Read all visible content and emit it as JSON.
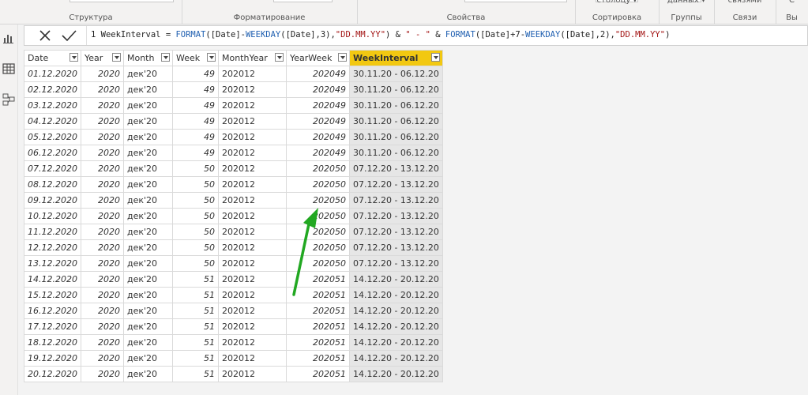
{
  "ribbon": {
    "groups": [
      {
        "label": "Структура",
        "top": ""
      },
      {
        "label": "Форматирование",
        "top": ""
      },
      {
        "label": "Свойства",
        "top": ""
      },
      {
        "label": "Сортировка",
        "top": "столбцу ▾"
      },
      {
        "label": "Группы",
        "top": "данных ▾"
      },
      {
        "label": "Связи",
        "top": "связями"
      },
      {
        "label": "Вы",
        "top": "С"
      }
    ]
  },
  "rail": {
    "icons": [
      "report-view-icon",
      "data-view-icon",
      "model-view-icon"
    ]
  },
  "formula": {
    "line_number": "1",
    "measure_name": "WeekInterval",
    "segments": [
      {
        "t": "1  WeekInterval = ",
        "c": ""
      },
      {
        "t": "FORMAT",
        "c": "kw"
      },
      {
        "t": "([Date]-",
        "c": ""
      },
      {
        "t": "WEEKDAY",
        "c": "kw"
      },
      {
        "t": "([Date],3),",
        "c": ""
      },
      {
        "t": "\"DD.MM.YY\"",
        "c": "st"
      },
      {
        "t": ") & ",
        "c": ""
      },
      {
        "t": "\" - \"",
        "c": "st"
      },
      {
        "t": " & ",
        "c": ""
      },
      {
        "t": "FORMAT",
        "c": "kw"
      },
      {
        "t": "([Date]+7-",
        "c": ""
      },
      {
        "t": "WEEKDAY",
        "c": "kw"
      },
      {
        "t": "([Date],2),",
        "c": ""
      },
      {
        "t": "\"DD.MM.YY\"",
        "c": "st"
      },
      {
        "t": ")",
        "c": ""
      }
    ]
  },
  "table": {
    "columns": [
      "Date",
      "Year",
      "Month",
      "Week",
      "MonthYear",
      "YearWeek",
      "WeekInterval"
    ],
    "selected_column": "WeekInterval",
    "rows": [
      [
        "01.12.2020",
        "2020",
        "дек'20",
        "49",
        "202012",
        "202049",
        "30.11.20 - 06.12.20"
      ],
      [
        "02.12.2020",
        "2020",
        "дек'20",
        "49",
        "202012",
        "202049",
        "30.11.20 - 06.12.20"
      ],
      [
        "03.12.2020",
        "2020",
        "дек'20",
        "49",
        "202012",
        "202049",
        "30.11.20 - 06.12.20"
      ],
      [
        "04.12.2020",
        "2020",
        "дек'20",
        "49",
        "202012",
        "202049",
        "30.11.20 - 06.12.20"
      ],
      [
        "05.12.2020",
        "2020",
        "дек'20",
        "49",
        "202012",
        "202049",
        "30.11.20 - 06.12.20"
      ],
      [
        "06.12.2020",
        "2020",
        "дек'20",
        "49",
        "202012",
        "202049",
        "30.11.20 - 06.12.20"
      ],
      [
        "07.12.2020",
        "2020",
        "дек'20",
        "50",
        "202012",
        "202050",
        "07.12.20 - 13.12.20"
      ],
      [
        "08.12.2020",
        "2020",
        "дек'20",
        "50",
        "202012",
        "202050",
        "07.12.20 - 13.12.20"
      ],
      [
        "09.12.2020",
        "2020",
        "дек'20",
        "50",
        "202012",
        "202050",
        "07.12.20 - 13.12.20"
      ],
      [
        "10.12.2020",
        "2020",
        "дек'20",
        "50",
        "202012",
        "202050",
        "07.12.20 - 13.12.20"
      ],
      [
        "11.12.2020",
        "2020",
        "дек'20",
        "50",
        "202012",
        "202050",
        "07.12.20 - 13.12.20"
      ],
      [
        "12.12.2020",
        "2020",
        "дек'20",
        "50",
        "202012",
        "202050",
        "07.12.20 - 13.12.20"
      ],
      [
        "13.12.2020",
        "2020",
        "дек'20",
        "50",
        "202012",
        "202050",
        "07.12.20 - 13.12.20"
      ],
      [
        "14.12.2020",
        "2020",
        "дек'20",
        "51",
        "202012",
        "202051",
        "14.12.20 - 20.12.20"
      ],
      [
        "15.12.2020",
        "2020",
        "дек'20",
        "51",
        "202012",
        "202051",
        "14.12.20 - 20.12.20"
      ],
      [
        "16.12.2020",
        "2020",
        "дек'20",
        "51",
        "202012",
        "202051",
        "14.12.20 - 20.12.20"
      ],
      [
        "17.12.2020",
        "2020",
        "дек'20",
        "51",
        "202012",
        "202051",
        "14.12.20 - 20.12.20"
      ],
      [
        "18.12.2020",
        "2020",
        "дек'20",
        "51",
        "202012",
        "202051",
        "14.12.20 - 20.12.20"
      ],
      [
        "19.12.2020",
        "2020",
        "дек'20",
        "51",
        "202012",
        "202051",
        "14.12.20 - 20.12.20"
      ],
      [
        "20.12.2020",
        "2020",
        "дек'20",
        "51",
        "202012",
        "202051",
        "14.12.20 - 20.12.20"
      ]
    ]
  },
  "colors": {
    "selected_header": "#f2c811",
    "keyword": "#1f5fb0",
    "string": "#a31515",
    "annotation_arrow": "#22a822"
  },
  "annotation": {
    "type": "arrow",
    "icon": "green-arrow-annotation"
  }
}
